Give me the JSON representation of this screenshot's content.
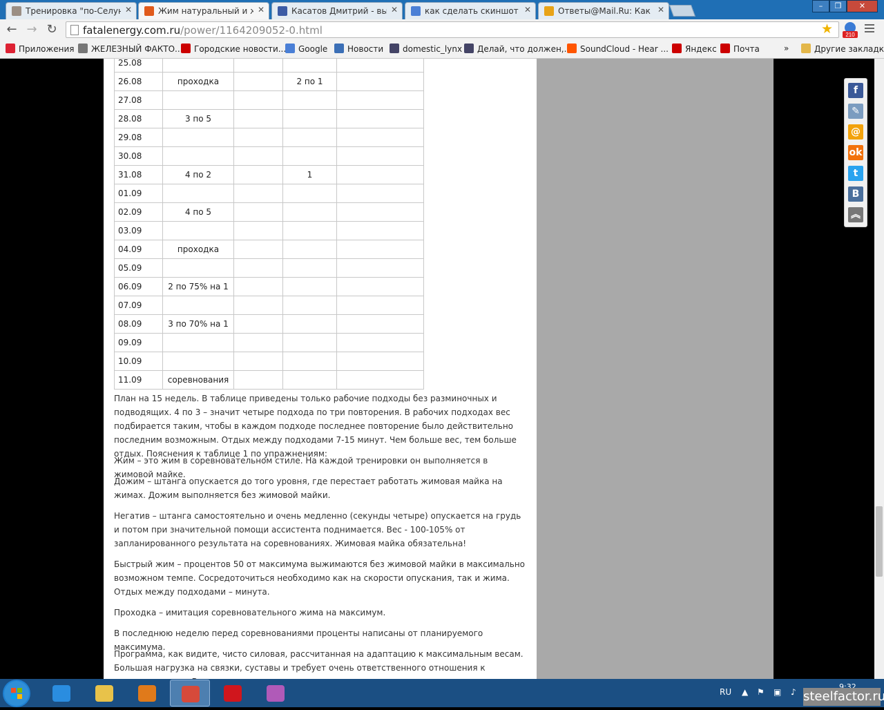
{
  "tabs": [
    {
      "title": "Тренировка \"по-Селуно",
      "favicon_color": "#9b8f85"
    },
    {
      "title": "Жим натуральный и жим",
      "favicon_color": "#e05a1b"
    },
    {
      "title": "Касатов Дмитрий - высту",
      "favicon_color": "#3b5ba5"
    },
    {
      "title": "как сделать скиншот и гд",
      "favicon_color": "#4a7fd6"
    },
    {
      "title": "Ответы@Mail.Ru: Как сде",
      "favicon_color": "#e8a317"
    }
  ],
  "toolbar": {
    "url_host": "fatalenergy.com.ru",
    "url_path": "/power/1164209052-0.html",
    "badge": "210"
  },
  "bookmarks": [
    {
      "label": "Приложения",
      "icon": "apps-icon",
      "color": "#d23"
    },
    {
      "label": "ЖЕЛЕЗНЫЙ ФАКТО...",
      "icon": "athlete-icon",
      "color": "#777"
    },
    {
      "label": "Городские новости...",
      "icon": "e1-icon",
      "color": "#c00"
    },
    {
      "label": "Google",
      "icon": "google-icon",
      "color": "#4a7fd6"
    },
    {
      "label": "Новости",
      "icon": "b-icon",
      "color": "#3b6fb6"
    },
    {
      "label": "domestic_lynx",
      "icon": "user-icon",
      "color": "#446"
    },
    {
      "label": "Делай, что должен,...",
      "icon": "user-icon",
      "color": "#446"
    },
    {
      "label": "SoundCloud - Hear ...",
      "icon": "soundcloud-icon",
      "color": "#f50"
    },
    {
      "label": "Яндекс",
      "icon": "opera-icon",
      "color": "#c00"
    },
    {
      "label": "Почта",
      "icon": "opera-icon",
      "color": "#c00"
    },
    {
      "label": "»",
      "icon": "",
      "color": ""
    },
    {
      "label": "Другие закладки",
      "icon": "folder-icon",
      "color": "#e3b74a"
    }
  ],
  "table_rows": [
    [
      "25.08",
      "",
      "",
      "",
      ""
    ],
    [
      "26.08",
      "проходка",
      "",
      "2 по 1",
      ""
    ],
    [
      "27.08",
      "",
      "",
      "",
      ""
    ],
    [
      "28.08",
      "3 по 5",
      "",
      "",
      ""
    ],
    [
      "29.08",
      "",
      "",
      "",
      ""
    ],
    [
      "30.08",
      "",
      "",
      "",
      ""
    ],
    [
      "31.08",
      "4 по 2",
      "",
      "1",
      ""
    ],
    [
      "01.09",
      "",
      "",
      "",
      ""
    ],
    [
      "02.09",
      "4 по 5",
      "",
      "",
      ""
    ],
    [
      "03.09",
      "",
      "",
      "",
      ""
    ],
    [
      "04.09",
      "проходка",
      "",
      "",
      ""
    ],
    [
      "05.09",
      "",
      "",
      "",
      ""
    ],
    [
      "06.09",
      "2 по 75% на 1",
      "",
      "",
      ""
    ],
    [
      "07.09",
      "",
      "",
      "",
      ""
    ],
    [
      "08.09",
      "3 по 70% на 1",
      "",
      "",
      ""
    ],
    [
      "09.09",
      "",
      "",
      "",
      ""
    ],
    [
      "10.09",
      "",
      "",
      "",
      ""
    ],
    [
      "11.09",
      "соревнования",
      "",
      "",
      ""
    ]
  ],
  "paragraphs": [
    "План на 15 недель. В таблице приведены только рабочие подходы без разминочных и подводящих. 4 по 3 – значит четыре подхода по три повторения. В рабочих подходах вес подбирается таким, чтобы в каждом подходе последнее повторение было действительно последним возможным. Отдых между подходами 7-15 минут. Чем больше вес, тем больше отдых. Пояснения к таблице 1 по упражнениям:",
    "Жим – это жим в соревновательном стиле. На каждой тренировки он выполняется в жимовой майке.",
    "Дожим – штанга опускается до того уровня, где перестает работать жимовая майка на жимах. Дожим выполняется без жимовой майки.",
    "Негатив – штанга самостоятельно и очень медленно (секунды четыре) опускается на грудь и потом при значительной помощи ассистента поднимается. Вес - 100-105% от запланированного результата на соревнованиях. Жимовая майка обязательна!",
    "Быстрый жим – процентов 50 от максимума выжимаются без жимовой майки в максимально возможном темпе. Сосредоточиться необходимо как на скорости опускания, так и жима. Отдых между подходами – минута.",
    "Проходка – имитация соревновательного жима на максимум.",
    "В последнюю неделю перед соревнованиями проценты написаны от планируемого максимума.",
    "Программа, как видите, чисто силовая, рассчитанная на адаптацию к максимальным весам. Большая нагрузка на связки, суставы и требует очень ответственного отношения к восстановлению. В"
  ],
  "share_buttons": [
    {
      "name": "facebook-share-icon",
      "glyph": "f",
      "color": "#3b5998"
    },
    {
      "name": "livejournal-share-icon",
      "glyph": "✎",
      "color": "#7b9cc0"
    },
    {
      "name": "mailru-share-icon",
      "glyph": "@",
      "color": "#f2a20c"
    },
    {
      "name": "odnoklassniki-share-icon",
      "glyph": "ok",
      "color": "#f2720c"
    },
    {
      "name": "twitter-share-icon",
      "glyph": "t",
      "color": "#2aa3ef"
    },
    {
      "name": "vkontakte-share-icon",
      "glyph": "B",
      "color": "#4a6f9c"
    },
    {
      "name": "scroll-top-icon",
      "glyph": "︽",
      "color": "#777"
    }
  ],
  "taskbar": {
    "items": [
      {
        "name": "taskbar-ie",
        "color": "#2a8de0"
      },
      {
        "name": "taskbar-explorer",
        "color": "#e8c24a"
      },
      {
        "name": "taskbar-media-player",
        "color": "#e07a1b"
      },
      {
        "name": "taskbar-chrome",
        "color": "#d64a3b"
      },
      {
        "name": "taskbar-opera",
        "color": "#d0161d"
      },
      {
        "name": "taskbar-app",
        "color": "#b05ab8"
      }
    ],
    "lang": "RU",
    "time": "9:32"
  },
  "watermark": "steelfactor.ru"
}
